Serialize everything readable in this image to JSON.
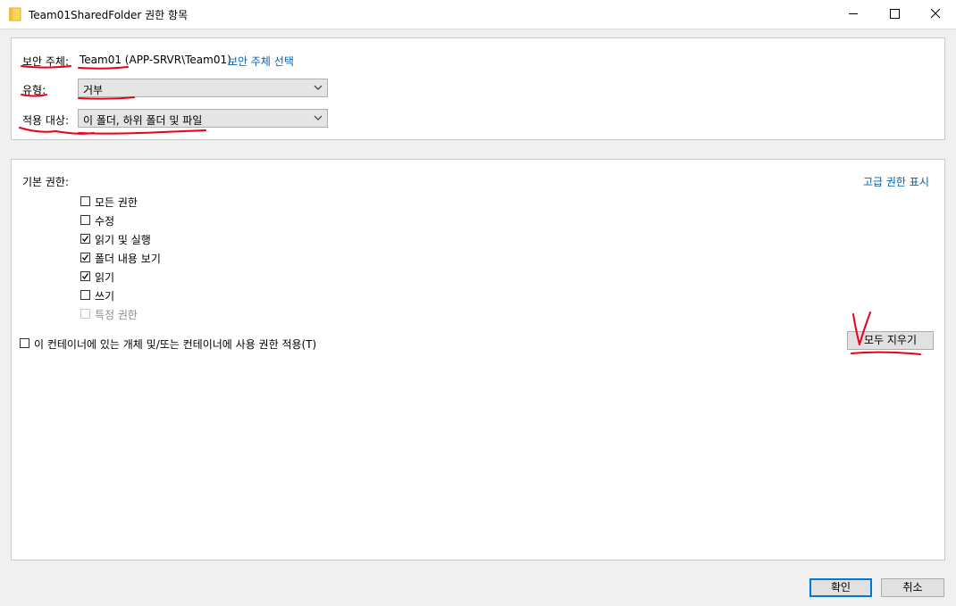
{
  "window": {
    "title": "Team01SharedFolder 권한 항목",
    "icons": {
      "folder": "folder-icon",
      "minimize": "minimize-icon",
      "maximize": "maximize-icon",
      "close": "close-icon"
    }
  },
  "principal": {
    "label": "보안 주체:",
    "value": "Team01 (APP-SRVR\\Team01)",
    "select_link": "보안 주체 선택"
  },
  "type": {
    "label": "유형:",
    "value": "거부"
  },
  "applies_to": {
    "label": "적용 대상:",
    "value": "이 폴더, 하위 폴더 및 파일"
  },
  "permissions": {
    "heading": "기본 권한:",
    "advanced_link": "고급 권한 표시",
    "items": [
      {
        "label": "모든 권한",
        "checked": false,
        "disabled": false
      },
      {
        "label": "수정",
        "checked": false,
        "disabled": false
      },
      {
        "label": "읽기 및 실행",
        "checked": true,
        "disabled": false
      },
      {
        "label": "폴더 내용 보기",
        "checked": true,
        "disabled": false
      },
      {
        "label": "읽기",
        "checked": true,
        "disabled": false
      },
      {
        "label": "쓰기",
        "checked": false,
        "disabled": false
      },
      {
        "label": "특정 권한",
        "checked": false,
        "disabled": true
      }
    ],
    "apply_container": {
      "label": "이 컨테이너에 있는 개체 및/또는 컨테이너에 사용 권한 적용(T)",
      "checked": false
    },
    "clear_all": "모두 지우기"
  },
  "footer": {
    "ok": "확인",
    "cancel": "취소"
  },
  "annotation_color": "#e8001c"
}
